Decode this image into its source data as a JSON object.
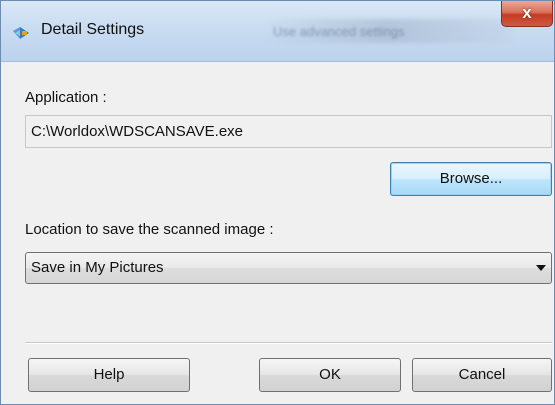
{
  "window": {
    "title": "Detail Settings",
    "close_label": "x",
    "background_hint": "Use advanced settings"
  },
  "application": {
    "label": "Application :",
    "path_value": "C:\\Worldox\\WDSCANSAVE.exe",
    "browse_label": "Browse..."
  },
  "location": {
    "label": "Location to save the scanned image :",
    "selected_option": "Save in My Pictures"
  },
  "footer": {
    "help_label": "Help",
    "ok_label": "OK",
    "cancel_label": "Cancel"
  },
  "colors": {
    "title_bar": "#c9dcf1",
    "close_button": "#c43c22",
    "focused_button": "#bee6fd",
    "dialog_background": "#f0f0f0"
  }
}
